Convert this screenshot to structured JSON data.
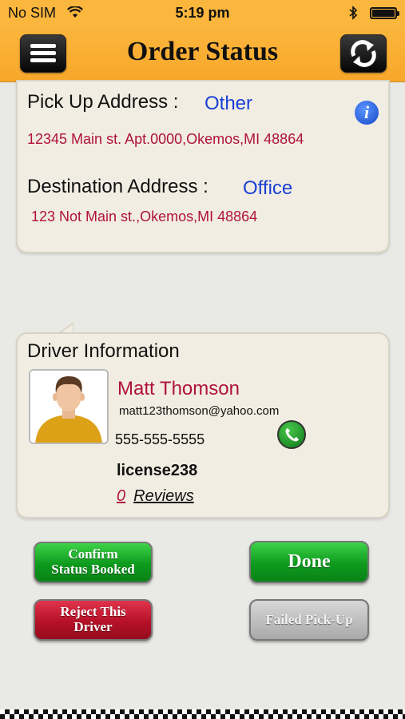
{
  "status_bar": {
    "carrier": "No SIM",
    "wifi_icon": "wifi-icon",
    "time": "5:19 pm",
    "bluetooth_icon": "bluetooth-icon",
    "battery_level": 1.0
  },
  "nav": {
    "title": "Order Status",
    "menu_icon": "hamburger-menu-icon",
    "refresh_icon": "refresh-icon"
  },
  "addresses": {
    "pickup_label": "Pick Up Address :",
    "pickup_tag": "Other",
    "pickup_address": "12345 Main st. Apt.0000,Okemos,MI 48864",
    "destination_label": "Destination Address :",
    "destination_tag": "Office",
    "destination_address": "123 Not Main st.,Okemos,MI 48864",
    "info_icon": "info-icon"
  },
  "driver": {
    "heading": "Driver Information",
    "name": "Matt Thomson",
    "email": "matt123thomson@yahoo.com",
    "phone": "555-555-5555",
    "license": "license238",
    "review_count": "0",
    "reviews_label": "Reviews",
    "call_icon": "phone-call-icon"
  },
  "actions": {
    "confirm_line1": "Confirm",
    "confirm_line2": "Status Booked",
    "done": "Done",
    "reject_line1": "Reject This",
    "reject_line2": "Driver",
    "failed": "Failed Pick-Up"
  },
  "colors": {
    "header": "#fbb63d",
    "accent_blue": "#1a3fd6",
    "address_red": "#b0123a",
    "button_green": "#0d9a1d",
    "button_red": "#b51127",
    "button_grey": "#a9a9a9"
  }
}
